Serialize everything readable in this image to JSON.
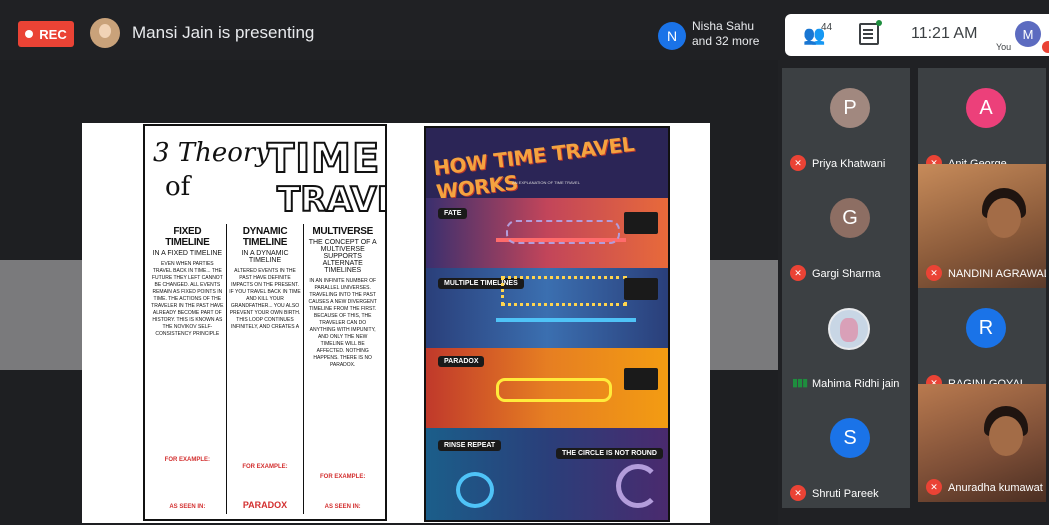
{
  "topbar": {
    "rec_label": "REC",
    "presenter_text": "Mansi Jain is presenting",
    "notification": {
      "avatar_letter": "N",
      "line1": "Nisha Sahu",
      "line2": "and 32 more"
    },
    "people_count": "44",
    "clock": "11:21 AM",
    "you_label": "You",
    "you_avatar_letter": "M"
  },
  "slide": {
    "left_poster": {
      "title_part1": "3 Theory",
      "title_part2": "of",
      "title_word1": "TIME",
      "title_word2": "TRAVEL",
      "columns": [
        {
          "heading": "FIXED TIMELINE",
          "sub": "IN A FIXED TIMELINE",
          "body": "EVEN WHEN PARTIES TRAVEL BACK IN TIME... THE FUTURE THEY LEFT CANNOT BE CHANGED. ALL EVENTS REMAIN AS FIXED POINTS IN TIME. THE ACTIONS OF THE TRAVELER IN THE PAST HAVE ALREADY BECOME PART OF HISTORY. THIS IS KNOWN AS THE NOVIKOV SELF-CONSISTENCY PRINCIPLE",
          "example": "FOR EXAMPLE:",
          "seen": "AS SEEN IN:"
        },
        {
          "heading": "DYNAMIC TIMELINE",
          "sub": "IN A DYNAMIC TIMELINE",
          "body": "ALTERED EVENTS IN THE PAST HAVE DEFINITE IMPACTS ON THE PRESENT. IF YOU TRAVEL BACK IN TIME AND KILL YOUR GRANDFATHER... YOU ALSO PREVENT YOUR OWN BIRTH. THIS LOOP CONTINUES INFINITELY, AND CREATES A",
          "example": "FOR EXAMPLE:",
          "seen": "PARADOX"
        },
        {
          "heading": "MULTIVERSE",
          "sub": "THE CONCEPT OF A MULTIVERSE SUPPORTS ALTERNATE TIMELINES",
          "body": "IN AN INFINITE NUMBER OF PARALLEL UNIVERSES. TRAVELING INTO THE PAST CAUSES A NEW DIVERGENT TIMELINE FROM THE FIRST. BECAUSE OF THIS, THE TRAVELER CAN DO ANYTHING WITH IMPUNITY, AND ONLY THE NEW TIMELINE WILL BE AFFECTED. NOTHING HAPPENS. THERE IS NO PARADOX.",
          "example": "FOR EXAMPLE:",
          "seen": "AS SEEN IN:"
        }
      ]
    },
    "right_poster": {
      "title": "HOW TIME TRAVEL WORKS",
      "subtitle": "AN EXPLANATION OF TIME TRAVEL",
      "sections": [
        "FATE",
        "MULTIPLE TIMELINES",
        "PARADOX",
        "RINSE REPEAT",
        "THE CIRCLE IS NOT ROUND"
      ]
    }
  },
  "participants": [
    {
      "name": "Priya Khatwani",
      "letter": "P",
      "color": "#a1887f",
      "type": "avatar"
    },
    {
      "name": "Anit George",
      "letter": "A",
      "color": "#ec407a",
      "type": "avatar"
    },
    {
      "name": "Gargi Sharma",
      "letter": "G",
      "color": "#8d6e63",
      "type": "avatar"
    },
    {
      "name": "NANDINI AGRAWAL",
      "letter": "",
      "color": "",
      "type": "video"
    },
    {
      "name": "Mahima Ridhi jain",
      "letter": "",
      "color": "",
      "type": "picture"
    },
    {
      "name": "RAGINI GOYAL",
      "letter": "R",
      "color": "#1a73e8",
      "type": "avatar"
    },
    {
      "name": "Shruti Pareek",
      "letter": "S",
      "color": "#1a73e8",
      "type": "avatar"
    },
    {
      "name": "Anuradha kumawat",
      "letter": "",
      "color": "",
      "type": "video"
    }
  ]
}
